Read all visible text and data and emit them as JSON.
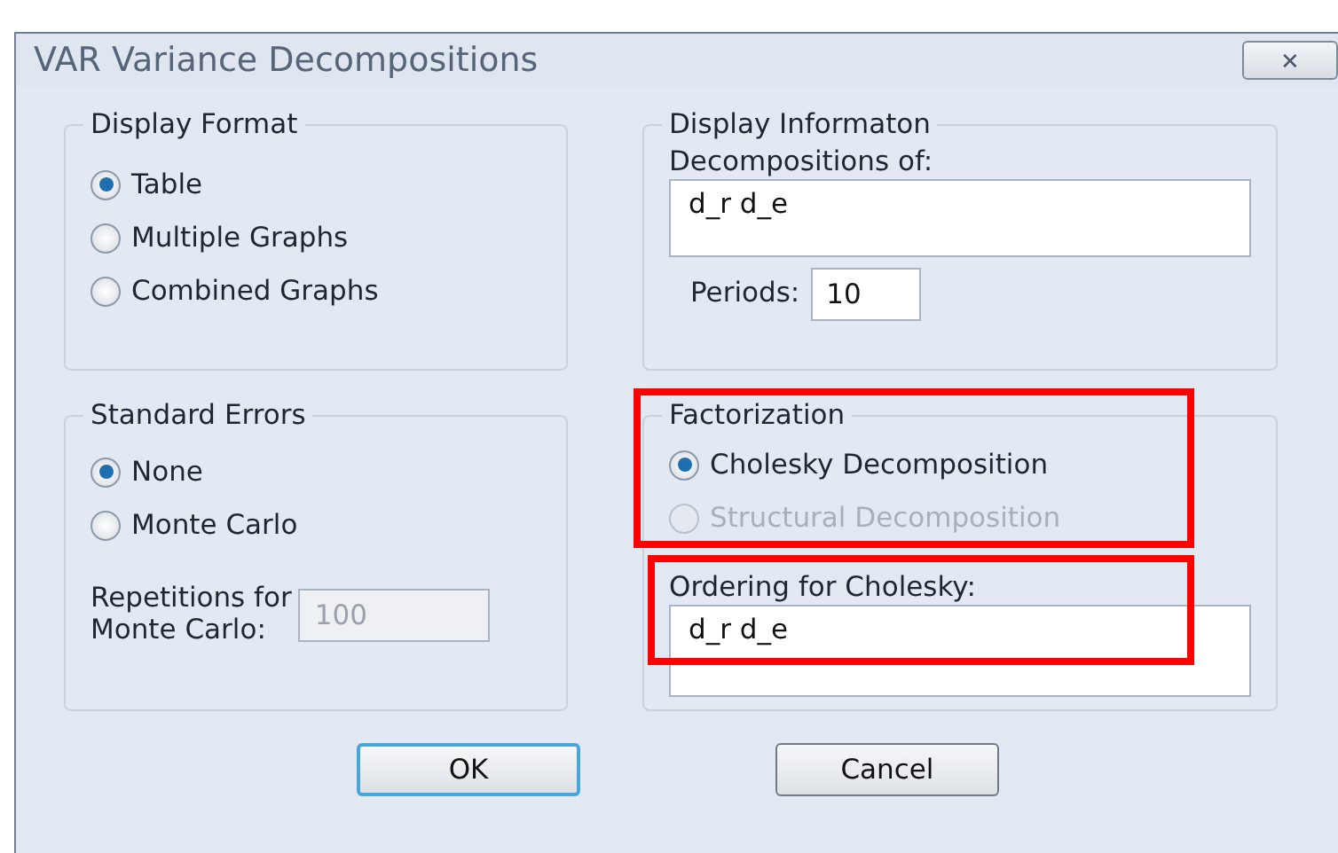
{
  "window": {
    "title": "VAR Variance Decompositions",
    "close": "✕"
  },
  "display_format": {
    "title": "Display Format",
    "options": [
      {
        "label": "Table",
        "selected": true
      },
      {
        "label": "Multiple Graphs",
        "selected": false
      },
      {
        "label": "Combined Graphs",
        "selected": false
      }
    ]
  },
  "display_information": {
    "title": "Display Informaton",
    "decompositions_label": "Decompositions of:",
    "decompositions_value": "d_r d_e",
    "periods_label": "Periods:",
    "periods_value": "10"
  },
  "standard_errors": {
    "title": "Standard Errors",
    "options": [
      {
        "label": "None",
        "selected": true,
        "disabled": false
      },
      {
        "label": "Monte Carlo",
        "selected": false,
        "disabled": false
      }
    ],
    "repetitions_label": "Repetitions for\nMonte Carlo:",
    "repetitions_value": "100",
    "repetitions_disabled": true
  },
  "factorization": {
    "title": "Factorization",
    "highlighted": true,
    "options": [
      {
        "label": "Cholesky Decomposition",
        "selected": true,
        "disabled": false
      },
      {
        "label": "Structural Decomposition",
        "selected": false,
        "disabled": true
      }
    ],
    "ordering_label": "Ordering for Cholesky:",
    "ordering_value": "d_r d_e",
    "ordering_highlighted": true
  },
  "buttons": [
    {
      "label": "OK",
      "default": true
    },
    {
      "label": "Cancel",
      "default": false
    }
  ]
}
